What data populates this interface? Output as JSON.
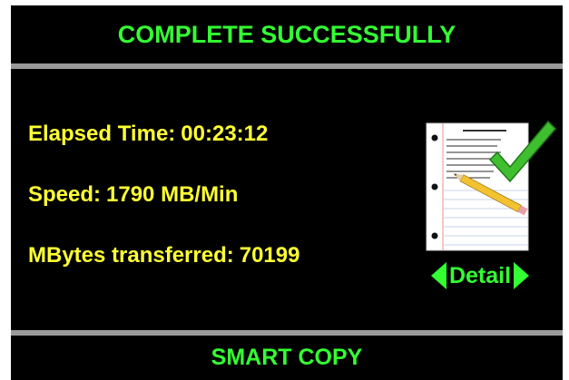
{
  "header": {
    "title": "COMPLETE SUCCESSFULLY"
  },
  "stats": {
    "elapsed_label": "Elapsed Time:",
    "elapsed_value": "00:23:12",
    "speed_label": "Speed:",
    "speed_value": "1790 MB/Min",
    "mbytes_label": "MBytes transferred:",
    "mbytes_value": "70199"
  },
  "detail": {
    "label": "Detail",
    "icon": "document-checkmark-icon",
    "prev_icon": "arrow-left-icon",
    "next_icon": "arrow-right-icon"
  },
  "footer": {
    "title": "SMART COPY"
  },
  "colors": {
    "background": "#000000",
    "header_text": "#33ff33",
    "stat_text": "#ffff33",
    "divider": "#9a9a9a"
  }
}
